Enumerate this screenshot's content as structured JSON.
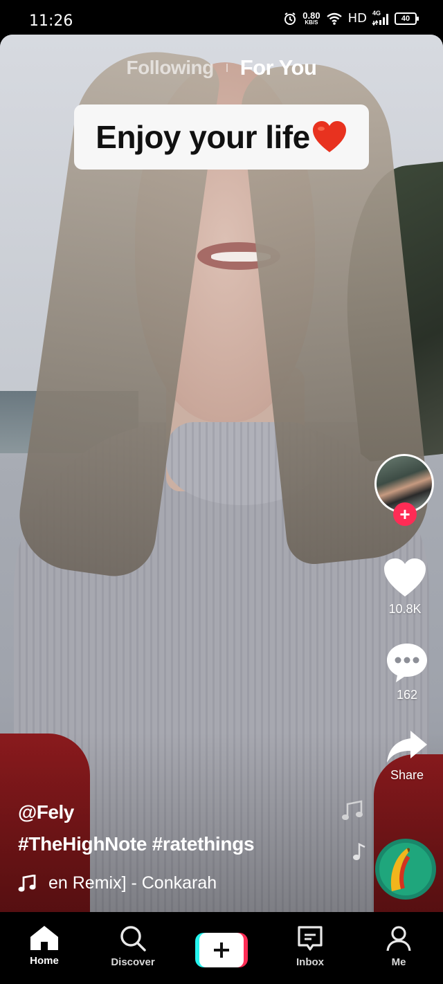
{
  "status_bar": {
    "time": "11:26",
    "net_speed": "0.80",
    "net_speed_unit": "KB/S",
    "hd": "HD",
    "signal": "4G",
    "battery": "40"
  },
  "top_tabs": {
    "following": "Following",
    "for_you": "For You"
  },
  "video": {
    "caption_text": "Enjoy your life",
    "caption_emoji": "❤️"
  },
  "rail": {
    "avatar_icon": "profile-avatar",
    "follow_icon": "plus-icon",
    "likes": "10.8K",
    "comments": "162",
    "share": "Share"
  },
  "post": {
    "username": "@Fely",
    "hashtags": "#TheHighNote #ratethings",
    "music": "en Remix] - Conkarah"
  },
  "bottom_nav": {
    "home": "Home",
    "discover": "Discover",
    "inbox": "Inbox",
    "me": "Me"
  },
  "colors": {
    "accent_red": "#fe2c55",
    "accent_cyan": "#25f4ee",
    "nav_bg": "#000000"
  }
}
